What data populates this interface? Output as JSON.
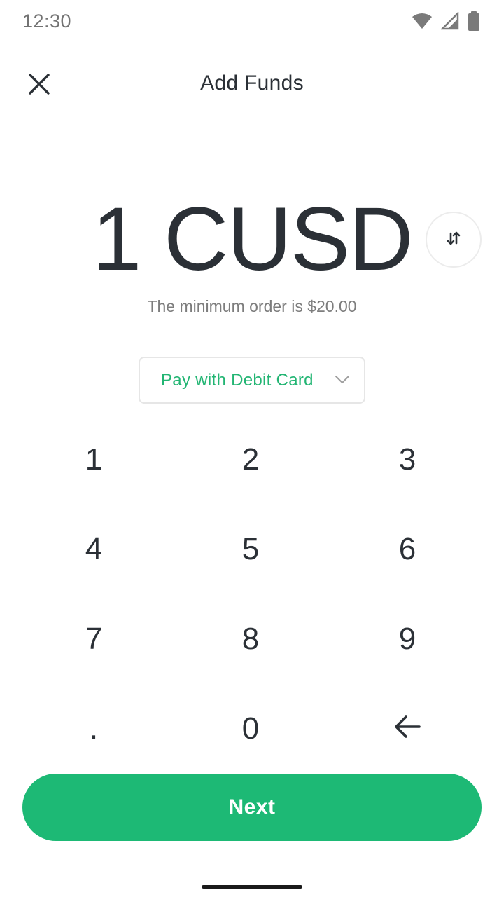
{
  "status_bar": {
    "time": "12:30",
    "icons": [
      "wifi-icon",
      "signal-icon",
      "battery-icon"
    ]
  },
  "header": {
    "title": "Add Funds",
    "close_icon": "close-icon"
  },
  "amount": {
    "value": "1 CUSD",
    "swap_icon": "swap-arrows-icon"
  },
  "min_order": "The minimum order is $20.00",
  "payment": {
    "selected": "Pay with Debit Card",
    "chevron_icon": "chevron-down-icon"
  },
  "keypad": {
    "keys": [
      "1",
      "2",
      "3",
      "4",
      "5",
      "6",
      "7",
      "8",
      "9",
      ".",
      "0"
    ],
    "backspace_icon": "backspace-arrow-icon"
  },
  "actions": {
    "next_label": "Next"
  },
  "colors": {
    "accent": "#1db975",
    "accent_text": "#22b573",
    "text_primary": "#2b3036",
    "text_secondary": "#7d7d7d"
  }
}
